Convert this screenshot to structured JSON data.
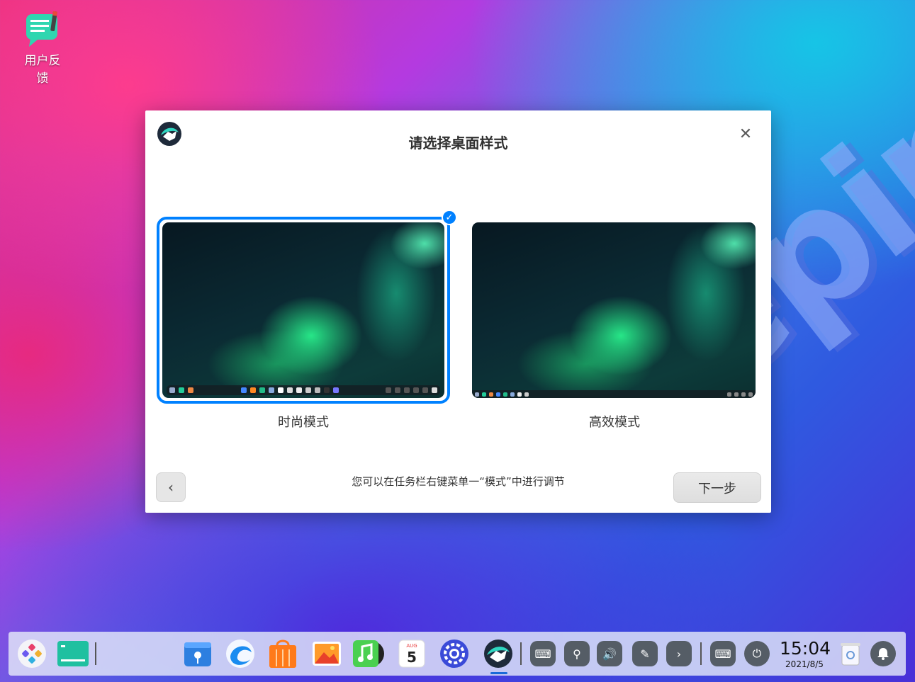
{
  "desktop": {
    "icon_label": "用户反馈",
    "wordmark": "deepin"
  },
  "dialog": {
    "title": "请选择桌面样式",
    "close_symbol": "✕",
    "options": [
      {
        "label": "时尚模式",
        "selected": true
      },
      {
        "label": "高效模式",
        "selected": false
      }
    ],
    "hint": "您可以在任务栏右键菜单一“模式”中进行调节",
    "back_symbol": "‹",
    "next_label": "下一步",
    "accent_color": "#0081ff"
  },
  "dock": {
    "apps": [
      {
        "name": "launcher-icon"
      },
      {
        "name": "terminal-icon"
      },
      {
        "name": "file-manager-icon"
      },
      {
        "name": "browser-icon"
      },
      {
        "name": "app-store-icon"
      },
      {
        "name": "image-viewer-icon"
      },
      {
        "name": "music-icon"
      },
      {
        "name": "calendar-icon",
        "month": "AUG",
        "day": "5"
      },
      {
        "name": "control-center-icon"
      },
      {
        "name": "welcome-icon"
      }
    ],
    "tray": [
      {
        "name": "keyboard-icon",
        "glyph": "⌨"
      },
      {
        "name": "usb-icon",
        "glyph": "⚲"
      },
      {
        "name": "volume-icon",
        "glyph": "🔊"
      },
      {
        "name": "pen-icon",
        "glyph": "✎"
      },
      {
        "name": "expand-icon",
        "glyph": "›"
      },
      {
        "name": "onscreen-keyboard-icon",
        "glyph": "⌨"
      },
      {
        "name": "power-icon",
        "glyph": "⏻"
      }
    ],
    "clock": {
      "time": "15:04",
      "date": "2021/8/5"
    }
  }
}
